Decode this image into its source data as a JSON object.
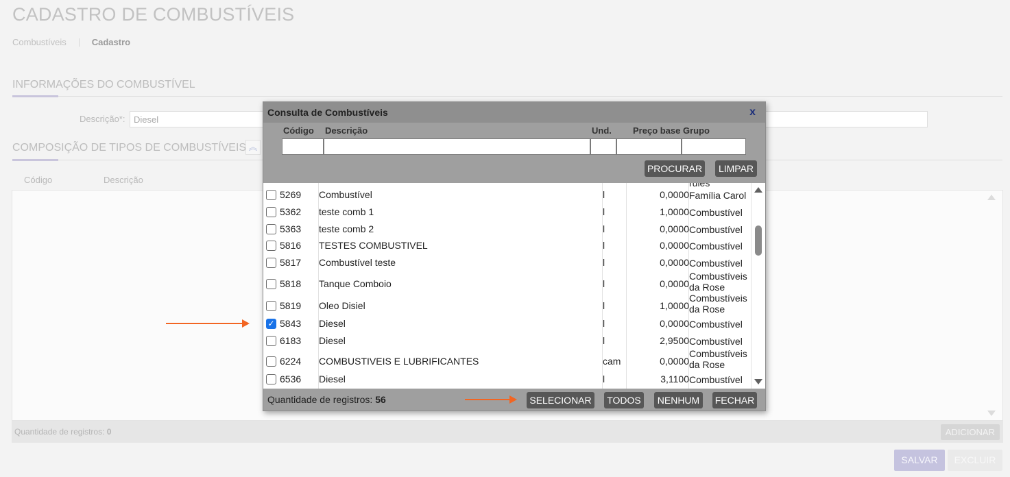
{
  "page": {
    "title": "CADASTRO DE COMBUSTÍVEIS",
    "breadcrumb": [
      "Combustíveis",
      "Cadastro"
    ]
  },
  "info_section": {
    "title": "INFORMAÇÕES DO COMBUSTÍVEL",
    "description_label": "Descrição*:",
    "description_value": "Diesel"
  },
  "composition_section": {
    "title": "COMPOSIÇÃO DE TIPOS DE COMBUSTÍVEIS",
    "columns": [
      "Código",
      "Descrição"
    ],
    "count_label": "Quantidade de registros:",
    "count_value": "0",
    "add_label": "ADICIONAR"
  },
  "actions": {
    "save_label": "SALVAR",
    "delete_label": "EXCLUIR"
  },
  "modal": {
    "title": "Consulta de Combustíveis",
    "close_label": "x",
    "filters": {
      "code_label": "Código",
      "desc_label": "Descrição",
      "unit_label": "Und.",
      "price_label": "Preço base",
      "group_label": "Grupo"
    },
    "search_label": "PROCURAR",
    "clear_label": "LIMPAR",
    "partial_top_text": "rules",
    "rows": [
      {
        "checked": false,
        "code": "5269",
        "description": "Combustível",
        "unit": "l",
        "price": "0,0000",
        "group": "Família Carol"
      },
      {
        "checked": false,
        "code": "5362",
        "description": "teste comb 1",
        "unit": "l",
        "price": "1,0000",
        "group": "Combustível"
      },
      {
        "checked": false,
        "code": "5363",
        "description": "teste comb 2",
        "unit": "l",
        "price": "0,0000",
        "group": "Combustível"
      },
      {
        "checked": false,
        "code": "5816",
        "description": "TESTES COMBUSTIVEL",
        "unit": "l",
        "price": "0,0000",
        "group": "Combustível"
      },
      {
        "checked": false,
        "code": "5817",
        "description": "Combustível teste",
        "unit": "l",
        "price": "0,0000",
        "group": "Combustível"
      },
      {
        "checked": false,
        "code": "5818",
        "description": "Tanque Comboio",
        "unit": "l",
        "price": "0,0000",
        "group": "Combustíveis da Rose"
      },
      {
        "checked": false,
        "code": "5819",
        "description": "Oleo Disiel",
        "unit": "l",
        "price": "1,0000",
        "group": "Combustíveis da Rose"
      },
      {
        "checked": true,
        "code": "5843",
        "description": "Diesel",
        "unit": "l",
        "price": "0,0000",
        "group": "Combustível"
      },
      {
        "checked": false,
        "code": "6183",
        "description": "Diesel",
        "unit": "l",
        "price": "2,9500",
        "group": "Combustível"
      },
      {
        "checked": false,
        "code": "6224",
        "description": "COMBUSTIVEIS E LUBRIFICANTES",
        "unit": "cam",
        "price": "0,0000",
        "group": "Combustíveis da Rose"
      },
      {
        "checked": false,
        "code": "6536",
        "description": "Diesel",
        "unit": "l",
        "price": "3,1100",
        "group": "Combustível"
      }
    ],
    "count_label": "Quantidade de registros:",
    "count_value": "56",
    "select_label": "SELECIONAR",
    "all_label": "TODOS",
    "none_label": "NENHUM",
    "close_button_label": "FECHAR"
  },
  "colors": {
    "annotation_arrow": "#f26522",
    "modal_gray": "#9f9f9f",
    "button_dark": "#575757",
    "checkbox_checked": "#1a73e8"
  }
}
